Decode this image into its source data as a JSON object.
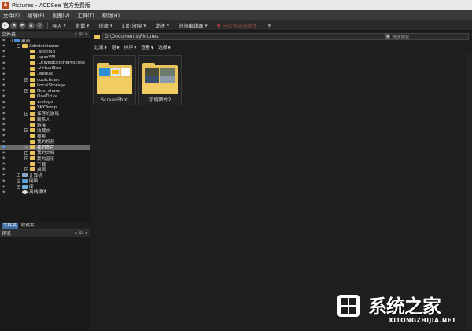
{
  "window": {
    "title": "Pictures - ACDSee 官方免费版",
    "app_icon": "acdsee-logo"
  },
  "menu": [
    {
      "label": "文件(F)"
    },
    {
      "label": "编辑(E)"
    },
    {
      "label": "视图(V)"
    },
    {
      "label": "工具(T)"
    },
    {
      "label": "帮助(H)"
    }
  ],
  "toolbar": {
    "nav": [
      "home-icon",
      "back-icon",
      "forward-icon",
      "up-icon",
      "refresh-icon"
    ],
    "items": [
      {
        "label": "导入",
        "enabled": true
      },
      {
        "label": "批量",
        "enabled": true
      },
      {
        "label": "创建",
        "enabled": true
      },
      {
        "label": "幻灯放映",
        "enabled": true
      },
      {
        "label": "发送",
        "enabled": true
      },
      {
        "label": "外部编辑器",
        "enabled": true
      },
      {
        "label": "分享到新浪微博",
        "enabled": false
      }
    ]
  },
  "folders_panel": {
    "title": "文件夹",
    "tree": [
      {
        "label": "桌面",
        "depth": 0,
        "expand": "-",
        "icon": "blue"
      },
      {
        "label": "Administrator",
        "depth": 1,
        "expand": "-",
        "icon": "folder"
      },
      {
        "label": ".android",
        "depth": 2,
        "expand": "",
        "icon": "folder"
      },
      {
        "label": ".kpzsVM",
        "depth": 2,
        "expand": "",
        "icon": "folder"
      },
      {
        "label": ".QtWebEngineProcess",
        "depth": 2,
        "expand": "",
        "icon": "folder"
      },
      {
        "label": ".VirtualBox",
        "depth": 2,
        "expand": "",
        "icon": "folder"
      },
      {
        "label": ".weikao",
        "depth": 2,
        "expand": "",
        "icon": "folder"
      },
      {
        "label": "coolchuan",
        "depth": 2,
        "expand": "+",
        "icon": "folder"
      },
      {
        "label": "LocalStorage",
        "depth": 2,
        "expand": "",
        "icon": "folder"
      },
      {
        "label": "Nox_share",
        "depth": 2,
        "expand": "+",
        "icon": "folder"
      },
      {
        "label": "OneDrive",
        "depth": 2,
        "expand": "",
        "icon": "folder"
      },
      {
        "label": "vmlogs",
        "depth": 2,
        "expand": "",
        "icon": "folder"
      },
      {
        "label": "YKYTemp",
        "depth": 2,
        "expand": "",
        "icon": "folder"
      },
      {
        "label": "保存的游戏",
        "depth": 2,
        "expand": "+",
        "icon": "folder"
      },
      {
        "label": "联系人",
        "depth": 2,
        "expand": "",
        "icon": "folder"
      },
      {
        "label": "链接",
        "depth": 2,
        "expand": "",
        "icon": "folder"
      },
      {
        "label": "收藏夹",
        "depth": 2,
        "expand": "+",
        "icon": "folder"
      },
      {
        "label": "搜索",
        "depth": 2,
        "expand": "",
        "icon": "folder"
      },
      {
        "label": "我的视频",
        "depth": 2,
        "expand": "",
        "icon": "folder"
      },
      {
        "label": "我的图片",
        "depth": 2,
        "expand": "+",
        "icon": "folder",
        "selected": true
      },
      {
        "label": "我的文档",
        "depth": 2,
        "expand": "+",
        "icon": "folder"
      },
      {
        "label": "我的音乐",
        "depth": 2,
        "expand": "+",
        "icon": "folder"
      },
      {
        "label": "下载",
        "depth": 2,
        "expand": "",
        "icon": "folder"
      },
      {
        "label": "桌面",
        "depth": 2,
        "expand": "+",
        "icon": "folder"
      },
      {
        "label": "计算机",
        "depth": 1,
        "expand": "+",
        "icon": "pc"
      },
      {
        "label": "网络",
        "depth": 1,
        "expand": "+",
        "icon": "net"
      },
      {
        "label": "库",
        "depth": 1,
        "expand": "+",
        "icon": "lib"
      },
      {
        "label": "离线媒体",
        "depth": 1,
        "expand": "",
        "icon": "disc"
      }
    ]
  },
  "panel_tabs": [
    {
      "label": "文件夹",
      "active": true
    },
    {
      "label": "收藏夹",
      "active": false
    }
  ],
  "preview_panel": {
    "title": "预览"
  },
  "address": {
    "path": "D:\\Documents\\Pictures"
  },
  "search": {
    "placeholder": "快速搜索"
  },
  "filter_bar": [
    {
      "label": "过滤"
    },
    {
      "label": "组"
    },
    {
      "label": "排序"
    },
    {
      "label": "查看"
    },
    {
      "label": "选择"
    }
  ],
  "thumbnails": [
    {
      "label": "ScreenShot"
    },
    {
      "label": "示例图片2"
    }
  ],
  "watermark": {
    "big": "系统之家",
    "small": "XITONGZHIJIA.NET"
  }
}
